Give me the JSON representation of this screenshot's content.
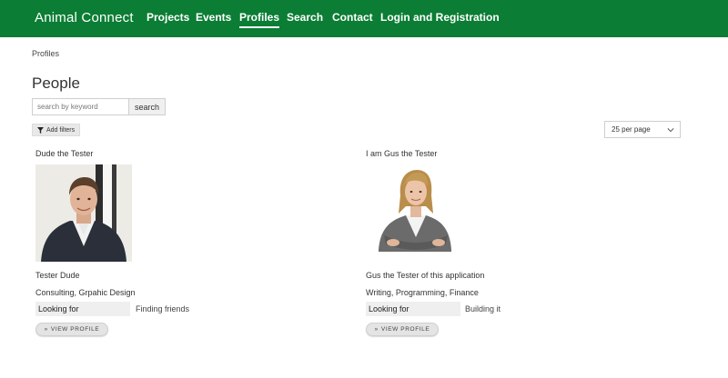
{
  "header": {
    "brand": "Animal Connect",
    "nav": [
      {
        "label": "Projects",
        "active": false
      },
      {
        "label": "Events",
        "active": false
      },
      {
        "label": "Profiles",
        "active": true
      },
      {
        "label": "Search",
        "active": false
      },
      {
        "label": "Contact",
        "active": false
      },
      {
        "label": "Login and Registration",
        "active": false
      }
    ]
  },
  "breadcrumb": "Profiles",
  "page_title": "People",
  "search": {
    "placeholder": "search by keyword",
    "value": "",
    "button_label": "search"
  },
  "filters": {
    "label": "Add filters",
    "icon": "filter-icon"
  },
  "per_page": {
    "selected": "25 per page",
    "icon": "chevron-down-icon"
  },
  "profiles": [
    {
      "title": "Dude the Tester",
      "name": "Tester Dude",
      "skills": "Consulting, Grpahic Design",
      "looking_for_label": "Looking for",
      "looking_for_value": "Finding friends",
      "button_label": "VIEW PROFILE"
    },
    {
      "title": "I am Gus the Tester",
      "name": "Gus the Tester of this application",
      "skills": "Writing, Programming, Finance",
      "looking_for_label": "Looking for",
      "looking_for_value": "Building it",
      "button_label": "VIEW PROFILE"
    }
  ],
  "colors": {
    "brand_green": "#0b7d34"
  }
}
